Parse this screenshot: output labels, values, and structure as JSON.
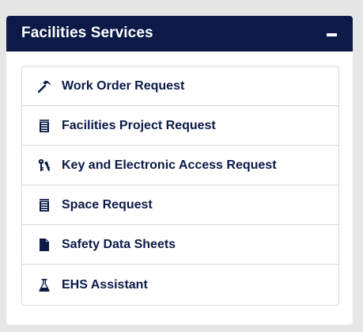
{
  "colors": {
    "header_bg": "#0b1a47",
    "header_text": "#ffffff",
    "item_text": "#0b1a47",
    "border": "#d9d9d9",
    "page_bg": "#e6e6e6"
  },
  "panel": {
    "title": "Facilities Services",
    "collapse_icon": "minus-icon"
  },
  "items": [
    {
      "label": "Work Order Request",
      "icon": "hammer-icon"
    },
    {
      "label": "Facilities Project Request",
      "icon": "notepad-icon"
    },
    {
      "label": "Key and Electronic Access Request",
      "icon": "keys-icon"
    },
    {
      "label": "Space Request",
      "icon": "notepad-icon"
    },
    {
      "label": "Safety Data Sheets",
      "icon": "document-icon"
    },
    {
      "label": "EHS Assistant",
      "icon": "flask-icon"
    }
  ]
}
